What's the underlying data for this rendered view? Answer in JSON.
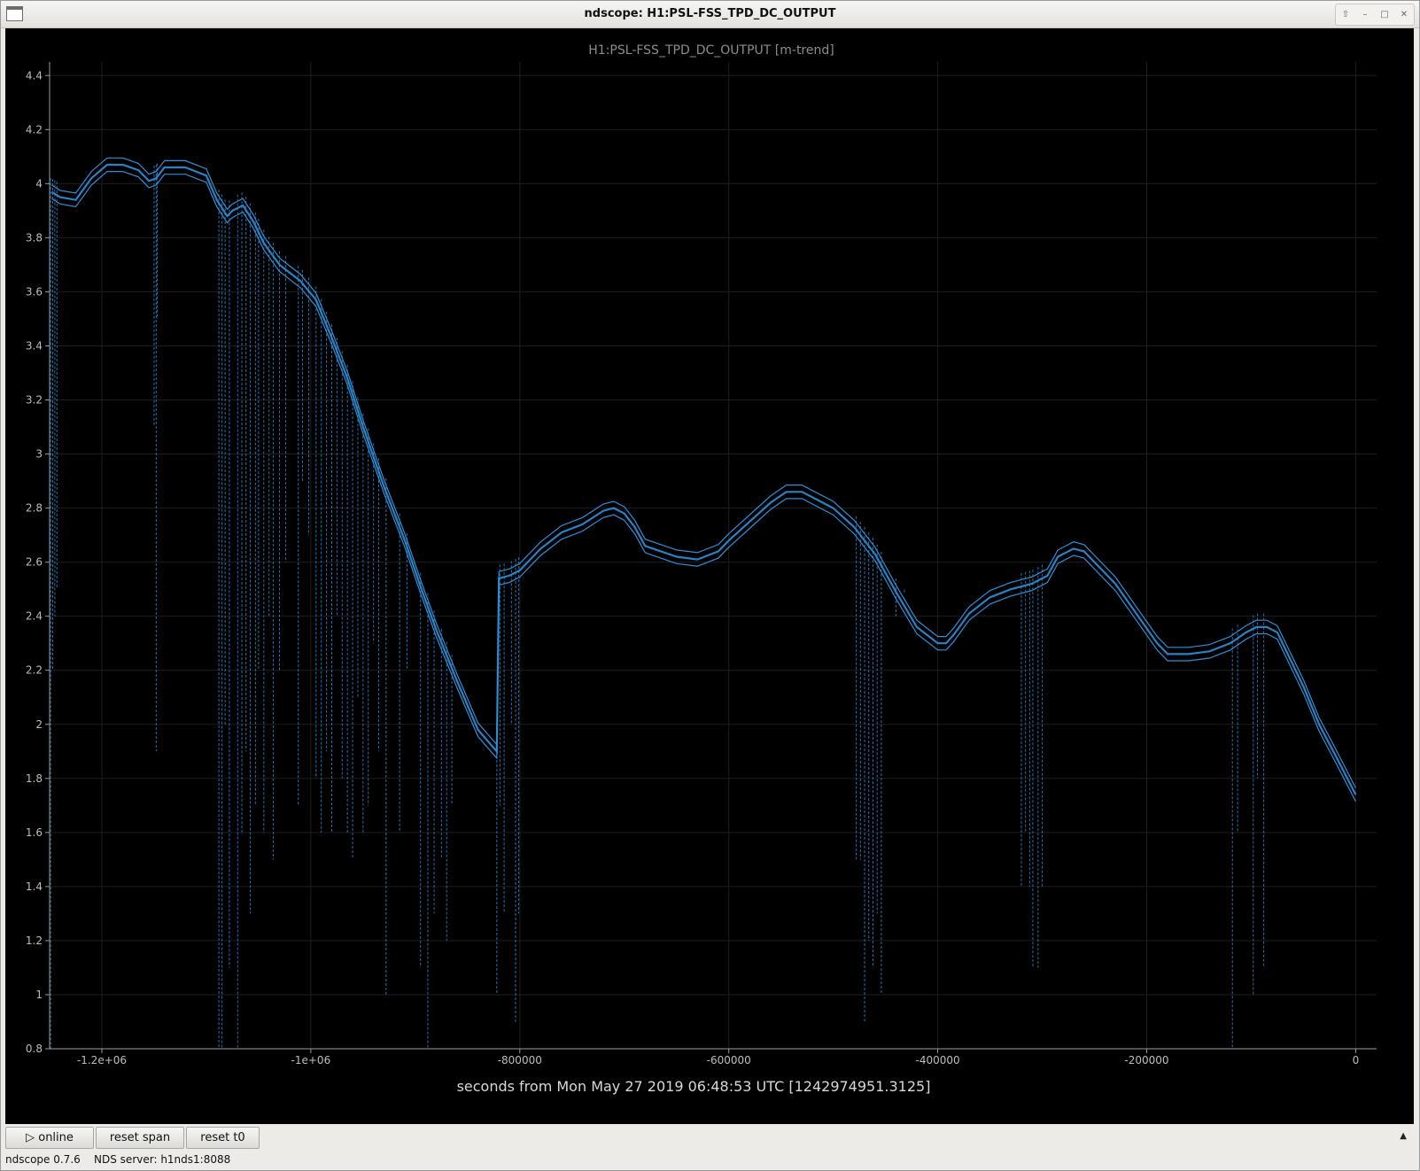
{
  "window": {
    "title": "ndscope: H1:PSL-FSS_TPD_DC_OUTPUT",
    "controls": [
      "up-icon",
      "minimize-icon",
      "maximize-icon",
      "close-icon"
    ]
  },
  "chart_data": {
    "type": "line",
    "title": "H1:PSL-FSS_TPD_DC_OUTPUT [m-trend]",
    "xlabel": "seconds from Mon May 27 2019 06:48:53 UTC [1242974951.3125]",
    "ylabel": "",
    "xlim": [
      -1250000,
      20000
    ],
    "ylim": [
      0.8,
      4.45
    ],
    "x_ticks": [
      -1200000,
      -1000000,
      -800000,
      -600000,
      -400000,
      -200000,
      0
    ],
    "x_tick_labels": [
      "-1.2e+06",
      "-1e+06",
      "-800000",
      "-600000",
      "-400000",
      "-200000",
      "0"
    ],
    "y_ticks": [
      0.8,
      1,
      1.2,
      1.4,
      1.6,
      1.8,
      2,
      2.2,
      2.4,
      2.6,
      2.8,
      3,
      3.2,
      3.4,
      3.6,
      3.8,
      4,
      4.2,
      4.4
    ],
    "y_tick_labels": [
      "0.8",
      "1",
      "1.2",
      "1.4",
      "1.6",
      "1.8",
      "2",
      "2.2",
      "2.4",
      "2.6",
      "2.8",
      "3",
      "3.2",
      "3.4",
      "3.6",
      "3.8",
      "4",
      "4.2",
      "4.4"
    ],
    "grid": true,
    "line_color": "#2f8fd8",
    "series": [
      {
        "name": "",
        "x": [
          -1248000,
          -1240000,
          -1225000,
          -1210000,
          -1195000,
          -1180000,
          -1165000,
          -1155000,
          -1148000,
          -1140000,
          -1120000,
          -1100000,
          -1090000,
          -1080000,
          -1075000,
          -1065000,
          -1055000,
          -1045000,
          -1030000,
          -1010000,
          -995000,
          -980000,
          -965000,
          -950000,
          -930000,
          -910000,
          -895000,
          -880000,
          -860000,
          -840000,
          -822000,
          -820000,
          -810000,
          -800000,
          -780000,
          -760000,
          -740000,
          -720000,
          -710000,
          -700000,
          -690000,
          -680000,
          -665000,
          -650000,
          -630000,
          -610000,
          -600000,
          -580000,
          -560000,
          -545000,
          -530000,
          -520000,
          -500000,
          -480000,
          -460000,
          -440000,
          -420000,
          -400000,
          -392000,
          -385000,
          -370000,
          -350000,
          -330000,
          -310000,
          -295000,
          -285000,
          -270000,
          -260000,
          -250000,
          -230000,
          -210000,
          -190000,
          -180000,
          -160000,
          -140000,
          -120000,
          -105000,
          -95000,
          -85000,
          -75000,
          -65000,
          -50000,
          -35000,
          -20000,
          0
        ],
        "y": [
          3.97,
          3.95,
          3.94,
          4.02,
          4.07,
          4.07,
          4.05,
          4.01,
          4.02,
          4.06,
          4.06,
          4.03,
          3.94,
          3.88,
          3.9,
          3.92,
          3.86,
          3.78,
          3.7,
          3.64,
          3.57,
          3.43,
          3.28,
          3.1,
          2.88,
          2.68,
          2.51,
          2.35,
          2.16,
          1.98,
          1.9,
          2.54,
          2.55,
          2.57,
          2.65,
          2.71,
          2.74,
          2.79,
          2.8,
          2.78,
          2.73,
          2.66,
          2.64,
          2.62,
          2.61,
          2.64,
          2.68,
          2.75,
          2.82,
          2.86,
          2.86,
          2.84,
          2.8,
          2.73,
          2.63,
          2.49,
          2.36,
          2.3,
          2.3,
          2.33,
          2.41,
          2.47,
          2.5,
          2.52,
          2.55,
          2.62,
          2.65,
          2.64,
          2.6,
          2.52,
          2.41,
          2.3,
          2.26,
          2.26,
          2.27,
          2.3,
          2.34,
          2.36,
          2.36,
          2.34,
          2.26,
          2.14,
          2.0,
          1.89,
          1.74
        ]
      }
    ],
    "spikes": [
      [
        -1249000,
        0.8
      ],
      [
        -1247000,
        2.2
      ],
      [
        -1245000,
        2.4
      ],
      [
        -1243000,
        2.5
      ],
      [
        -1150000,
        3.1
      ],
      [
        -1148000,
        1.9
      ],
      [
        -1147000,
        3.5
      ],
      [
        -1088000,
        0.8
      ],
      [
        -1085000,
        0.8
      ],
      [
        -1082000,
        2.0
      ],
      [
        -1078000,
        1.1
      ],
      [
        -1070000,
        0.8
      ],
      [
        -1066000,
        1.6
      ],
      [
        -1062000,
        1.9
      ],
      [
        -1058000,
        1.3
      ],
      [
        -1053000,
        1.7
      ],
      [
        -1050000,
        2.2
      ],
      [
        -1045000,
        1.6
      ],
      [
        -1040000,
        2.4
      ],
      [
        -1036000,
        1.5
      ],
      [
        -1030000,
        2.2
      ],
      [
        -1024000,
        2.6
      ],
      [
        -1012000,
        1.7
      ],
      [
        -1008000,
        2.9
      ],
      [
        -1002000,
        2.7
      ],
      [
        -995000,
        1.8
      ],
      [
        -990000,
        1.6
      ],
      [
        -985000,
        1.9
      ],
      [
        -980000,
        1.6
      ],
      [
        -975000,
        2.4
      ],
      [
        -970000,
        1.8
      ],
      [
        -965000,
        1.6
      ],
      [
        -960000,
        1.5
      ],
      [
        -955000,
        2.1
      ],
      [
        -950000,
        1.6
      ],
      [
        -945000,
        1.7
      ],
      [
        -940000,
        2.3
      ],
      [
        -935000,
        1.9
      ],
      [
        -928000,
        1.0
      ],
      [
        -915000,
        1.6
      ],
      [
        -908000,
        2.2
      ],
      [
        -895000,
        1.1
      ],
      [
        -888000,
        0.8
      ],
      [
        -882000,
        1.3
      ],
      [
        -875000,
        1.5
      ],
      [
        -870000,
        1.2
      ],
      [
        -865000,
        1.7
      ],
      [
        -822000,
        1.0
      ],
      [
        -819000,
        1.7
      ],
      [
        -815000,
        1.3
      ],
      [
        -808000,
        2.0
      ],
      [
        -804000,
        0.9
      ],
      [
        -801000,
        1.3
      ],
      [
        -478000,
        1.5
      ],
      [
        -474000,
        1.5
      ],
      [
        -470000,
        0.9
      ],
      [
        -466000,
        1.2
      ],
      [
        -462000,
        1.1
      ],
      [
        -458000,
        1.3
      ],
      [
        -454000,
        1.0
      ],
      [
        -440000,
        2.4
      ],
      [
        -432000,
        2.5
      ],
      [
        -320000,
        1.4
      ],
      [
        -316000,
        1.6
      ],
      [
        -312000,
        1.4
      ],
      [
        -309000,
        1.1
      ],
      [
        -304000,
        1.1
      ],
      [
        -300000,
        1.4
      ],
      [
        -118000,
        0.8
      ],
      [
        -113000,
        1.6
      ],
      [
        -98000,
        1.0
      ],
      [
        -94000,
        1.8
      ],
      [
        -88000,
        1.1
      ]
    ]
  },
  "toolbar": {
    "online_label": "online",
    "online_icon": "play-icon",
    "reset_span_label": "reset span",
    "reset_t0_label": "reset t0",
    "collapse_icon": "collapse-arrow-icon"
  },
  "status": {
    "version": "ndscope 0.7.6",
    "server": "NDS server: h1nds1:8088"
  }
}
